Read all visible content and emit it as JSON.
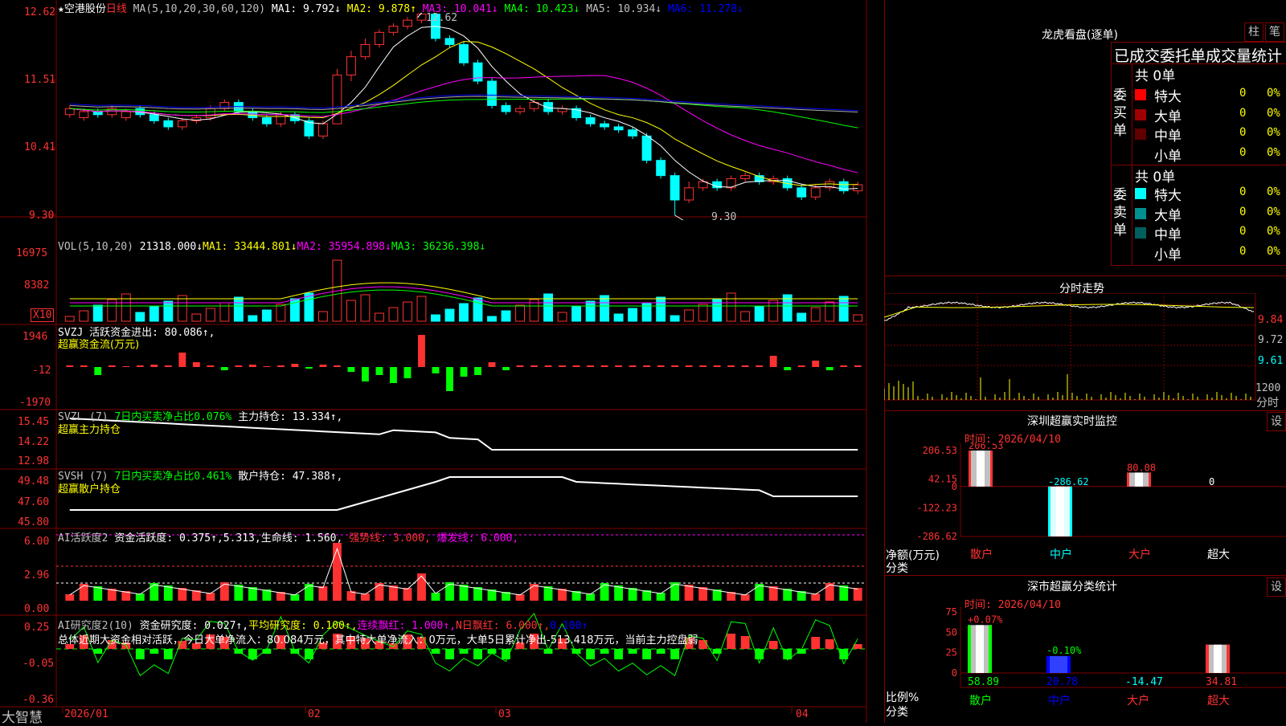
{
  "colors": {
    "up": "#ff3232",
    "down": "#00ffff",
    "grid": "#800000",
    "yellow": "#ffff00",
    "magenta": "#ff00ff",
    "green": "#00ff00",
    "white": "#ffffff",
    "blue": "#0000ff",
    "gray": "#aaaaaa"
  },
  "header": {
    "star_title": "★空港股份",
    "period": "日线",
    "ma_label": "MA(5,10,20,30,60,120)",
    "ma1": "MA1: 9.792↓",
    "ma2": "MA2: 9.878↑",
    "ma3": "MA3: 10.041↓",
    "ma4": "MA4: 10.423↓",
    "ma5": "MA5: 10.934↓",
    "ma6": "MA6: 11.278↓"
  },
  "price_axis": [
    "12.62",
    "11.51",
    "10.41",
    "9.30"
  ],
  "price_annotations": {
    "high": "12.62",
    "low": "9.30"
  },
  "vol_header": {
    "label": "VOL(5,10,20)",
    "vol": "21318.000↓",
    "ma1": "MA1: 33444.801↓",
    "ma2": "MA2: 35954.898↓",
    "ma3": "MA3: 36236.398↓"
  },
  "vol_axis": [
    "16975",
    "8382"
  ],
  "vol_unit": "X10",
  "svzj": {
    "label": "SVZJ  活跃资金进出: 80.086↑,",
    "subtitle": "超赢资金流(万元)",
    "axis": [
      "1946",
      "-12",
      "-1970"
    ]
  },
  "svzl": {
    "label": "SVZL (7)",
    "ratio": "7日内买卖净占比0.076%",
    "hold": "主力持仓: 13.334↑,",
    "subtitle": "超赢主力持仓",
    "axis": [
      "15.45",
      "14.22",
      "12.98"
    ]
  },
  "svsh": {
    "label": "SVSH (7)",
    "ratio": "7日内买卖净占比0.461%",
    "hold": "散户持仓: 47.388↑,",
    "subtitle": "超赢散户持仓",
    "axis": [
      "49.48",
      "47.60",
      "45.80"
    ]
  },
  "ai1": {
    "label": "AI活跃度2",
    "active": "资金活跃度: 0.375↑,5.313,",
    "life": "生命线: 1.560,",
    "strong": "强势线: 3.000,",
    "burst": "爆发线: 6.000,",
    "axis": [
      "6.00",
      "2.96",
      "0.00"
    ]
  },
  "ai2": {
    "label": "AI研究度2(10)",
    "research": "资金研究度: 0.027↑,",
    "avg": "平均研究度: 0.100↑,",
    "red": "连续飘红: 1.000↑,",
    "nred": "N日飘红: 6.000↑,",
    "last": "0.100↑",
    "summary": "总体近期大资金相对活跃，今日大单净流入：80.084万元，其中特大单净流入：0万元，大单5日累计净出-513.418万元，当前主力控盘弱",
    "axis": [
      "0.25",
      "-0.05",
      "-0.36"
    ]
  },
  "time_axis": [
    "2026/01",
    "02",
    "03",
    "04"
  ],
  "brand": "大智慧",
  "chart_data": {
    "type": "candlestick",
    "price_range": [
      9.3,
      12.62
    ],
    "candles": [
      [
        10.95,
        11.05,
        11.1,
        10.9
      ],
      [
        10.9,
        11.0,
        11.05,
        10.85
      ],
      [
        11.0,
        10.95,
        11.05,
        10.9
      ],
      [
        10.95,
        11.05,
        11.1,
        10.9
      ],
      [
        10.9,
        11.0,
        11.05,
        10.85
      ],
      [
        11.05,
        10.95,
        11.1,
        10.9
      ],
      [
        10.95,
        10.85,
        11.0,
        10.8
      ],
      [
        10.85,
        10.75,
        10.9,
        10.7
      ],
      [
        10.75,
        10.85,
        10.9,
        10.7
      ],
      [
        10.85,
        10.9,
        10.95,
        10.8
      ],
      [
        10.9,
        11.05,
        11.1,
        10.85
      ],
      [
        11.05,
        11.15,
        11.2,
        11.0
      ],
      [
        11.15,
        11.0,
        11.2,
        10.95
      ],
      [
        11.0,
        10.9,
        11.05,
        10.85
      ],
      [
        10.9,
        10.8,
        10.95,
        10.75
      ],
      [
        10.8,
        10.95,
        11.0,
        10.75
      ],
      [
        10.95,
        10.85,
        11.0,
        10.8
      ],
      [
        10.85,
        10.6,
        10.9,
        10.55
      ],
      [
        10.6,
        10.8,
        10.85,
        10.55
      ],
      [
        10.8,
        11.6,
        11.7,
        10.8
      ],
      [
        11.6,
        11.9,
        12.0,
        11.5
      ],
      [
        11.9,
        12.1,
        12.2,
        11.85
      ],
      [
        12.1,
        12.3,
        12.35,
        12.05
      ],
      [
        12.3,
        12.4,
        12.45,
        12.25
      ],
      [
        12.4,
        12.5,
        12.55,
        12.35
      ],
      [
        12.5,
        12.6,
        12.62,
        12.45
      ],
      [
        12.6,
        12.2,
        12.62,
        12.15
      ],
      [
        12.2,
        12.1,
        12.25,
        12.05
      ],
      [
        12.1,
        11.8,
        12.15,
        11.75
      ],
      [
        11.8,
        11.5,
        11.85,
        11.45
      ],
      [
        11.5,
        11.1,
        11.55,
        11.05
      ],
      [
        11.1,
        11.0,
        11.15,
        10.95
      ],
      [
        11.0,
        11.05,
        11.1,
        10.95
      ],
      [
        11.05,
        11.15,
        11.2,
        11.0
      ],
      [
        11.15,
        11.0,
        11.2,
        10.95
      ],
      [
        11.0,
        11.05,
        11.1,
        10.95
      ],
      [
        11.05,
        10.9,
        11.1,
        10.85
      ],
      [
        10.9,
        10.8,
        10.95,
        10.75
      ],
      [
        10.8,
        10.75,
        10.85,
        10.7
      ],
      [
        10.75,
        10.7,
        10.8,
        10.65
      ],
      [
        10.7,
        10.6,
        10.75,
        10.55
      ],
      [
        10.6,
        10.2,
        10.65,
        10.15
      ],
      [
        10.2,
        9.95,
        10.25,
        9.9
      ],
      [
        9.95,
        9.55,
        10.0,
        9.3
      ],
      [
        9.55,
        9.75,
        9.85,
        9.5
      ],
      [
        9.75,
        9.85,
        9.9,
        9.7
      ],
      [
        9.85,
        9.75,
        9.9,
        9.7
      ],
      [
        9.75,
        9.9,
        9.95,
        9.7
      ],
      [
        9.9,
        9.95,
        10.0,
        9.85
      ],
      [
        9.95,
        9.85,
        10.0,
        9.8
      ],
      [
        9.85,
        9.9,
        9.95,
        9.8
      ],
      [
        9.9,
        9.75,
        9.95,
        9.7
      ],
      [
        9.75,
        9.6,
        9.8,
        9.55
      ],
      [
        9.6,
        9.75,
        9.8,
        9.55
      ],
      [
        9.75,
        9.85,
        9.9,
        9.7
      ],
      [
        9.85,
        9.7,
        9.9,
        9.65
      ],
      [
        9.7,
        9.8,
        9.85,
        9.65
      ]
    ]
  },
  "right": {
    "dragon_title": "龙虎看盘(逐单)",
    "btn_bar": "柱",
    "btn_stroke": "笔",
    "stat_title": "已成交委托单成交量统计",
    "buy_label": "委买单",
    "sell_label": "委卖单",
    "buy_total": "共 0单",
    "sell_total": "共 0单",
    "buy_rows": [
      {
        "name": "特大",
        "val": "0",
        "pct": "0%",
        "color": "#ff0000"
      },
      {
        "name": "大单",
        "val": "0",
        "pct": "0%",
        "color": "#a00000"
      },
      {
        "name": "中单",
        "val": "0",
        "pct": "0%",
        "color": "#600000"
      },
      {
        "name": "小单",
        "val": "0",
        "pct": "0%",
        "color": "#000000"
      }
    ],
    "sell_rows": [
      {
        "name": "特大",
        "val": "0",
        "pct": "0%",
        "color": "#00ffff"
      },
      {
        "name": "大单",
        "val": "0",
        "pct": "0%",
        "color": "#009090"
      },
      {
        "name": "中单",
        "val": "0",
        "pct": "0%",
        "color": "#006060"
      },
      {
        "name": "小单",
        "val": "0",
        "pct": "0%",
        "color": "#000000"
      }
    ],
    "minute_title": "分时走势",
    "minute_axis": [
      "9.84",
      "9.72",
      "9.61",
      "1200",
      "分时"
    ],
    "monitor_title": "深圳超赢实时监控",
    "monitor_btn": "设",
    "monitor_time": "时间: 2026/04/10",
    "monitor_axis": [
      "206.53",
      "42.15",
      "0",
      "-122.23",
      "-286.62"
    ],
    "monitor_ylabel": "净额(万元)",
    "monitor_xlabel": "分类",
    "monitor_bars": [
      {
        "cat": "散户",
        "val": "206.53"
      },
      {
        "cat": "中户",
        "val": "-286.62"
      },
      {
        "cat": "大户",
        "val": "80.08"
      },
      {
        "cat": "超大",
        "val": "0"
      }
    ],
    "class_title": "深市超赢分类统计",
    "class_btn": "设",
    "class_time": "时间: 2026/04/10",
    "class_axis": [
      "75",
      "50",
      "25",
      "0"
    ],
    "class_ylabel": "比例%",
    "class_xlabel": "分类",
    "class_bars": [
      {
        "cat": "散户",
        "val": "58.89",
        "top": "+0.07%"
      },
      {
        "cat": "中户",
        "val": "20.78",
        "top": "-0.10%"
      },
      {
        "cat": "大户",
        "val": "-14.47",
        "top": ""
      },
      {
        "cat": "超大",
        "val": "34.81",
        "top": ""
      }
    ]
  }
}
